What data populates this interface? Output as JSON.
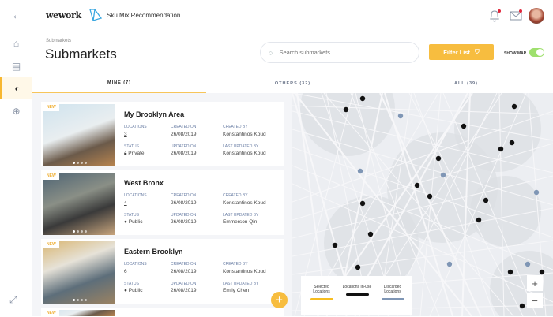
{
  "header": {
    "logo": "wework",
    "app_title": "Sku Mix Recommendation"
  },
  "page": {
    "breadcrumb": "Submarkets",
    "title": "Submarkets"
  },
  "search": {
    "placeholder": "Search submarkets..."
  },
  "filter": {
    "label": "Filter List"
  },
  "show_map": {
    "label": "SHOW MAP",
    "on": true
  },
  "tabs": [
    {
      "label": "MINE (7)",
      "active": true
    },
    {
      "label": "OTHERS (32)"
    },
    {
      "label": "ALL (39)"
    }
  ],
  "labels": {
    "new": "NEW",
    "locations": "LOCATIONS",
    "created_on": "CREATED ON",
    "created_by": "CREATED BY",
    "status": "STATUS",
    "updated_on": "UPDATED ON",
    "last_updated_by": "LAST UPDATED BY"
  },
  "cards": [
    {
      "name": "My Brooklyn Area",
      "locations": "3",
      "created_on": "26/08/2019",
      "created_by": "Konstantinos Koud",
      "status": "Private",
      "updated_on": "26/08/2019",
      "last_updated_by": "Konstantinos Koud"
    },
    {
      "name": "West Bronx",
      "locations": "4",
      "created_on": "26/08/2019",
      "created_by": "Konstantinos Koud",
      "status": "Public",
      "updated_on": "26/08/2019",
      "last_updated_by": "Emmerson Qin"
    },
    {
      "name": "Eastern Brooklyn",
      "locations": "6",
      "created_on": "26/08/2019",
      "created_by": "Konstantinos Koud",
      "status": "Public",
      "updated_on": "26/08/2019",
      "last_updated_by": "Emily Chen"
    }
  ],
  "legend": [
    {
      "label": "Selected Locations",
      "color": "#f7bd1f"
    },
    {
      "label": "Locations In-use",
      "color": "#111111"
    },
    {
      "label": "Discarded Locations",
      "color": "#7f96b5"
    }
  ],
  "colors": {
    "accent": "#f7bd3f",
    "toggle": "#9fe06e"
  }
}
